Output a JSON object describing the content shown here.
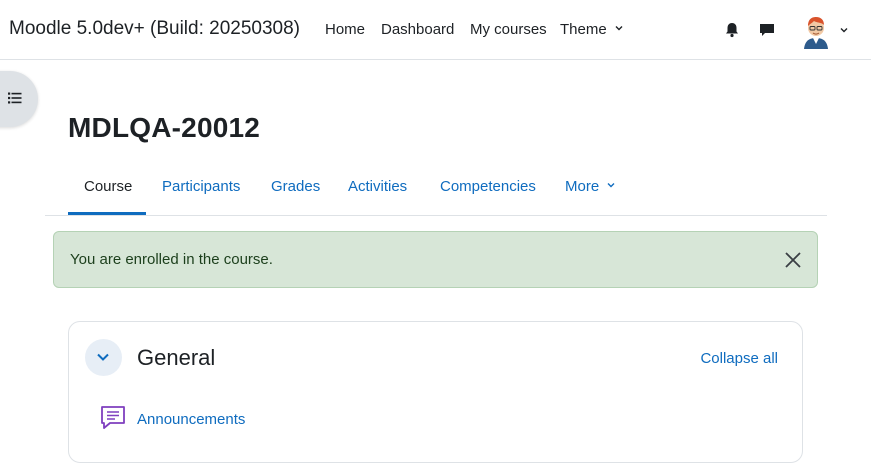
{
  "navbar": {
    "site_name": "Moodle 5.0dev+ (Build: 20250308)",
    "links": [
      "Home",
      "Dashboard",
      "My courses"
    ],
    "theme_label": "Theme",
    "icons": [
      "notifications-bell-icon",
      "messages-icon",
      "user-avatar",
      "chevron-down-icon"
    ]
  },
  "drawer": {
    "icon": "course-index-list-icon"
  },
  "page": {
    "title": "MDLQA-20012"
  },
  "secondary_nav": {
    "tabs": [
      "Course",
      "Participants",
      "Grades",
      "Activities",
      "Competencies"
    ],
    "more_label": "More",
    "active_tab": "Course"
  },
  "alert": {
    "message": "You are enrolled in the course.",
    "color": "#d7e6d7"
  },
  "section": {
    "title": "General",
    "collapse_all_label": "Collapse all",
    "activities": [
      {
        "label": "Announcements",
        "icon": "forum-icon"
      }
    ]
  },
  "colors": {
    "link": "#0f6cbf",
    "text": "#1d2125",
    "forum_icon": "#7f3fbf"
  }
}
